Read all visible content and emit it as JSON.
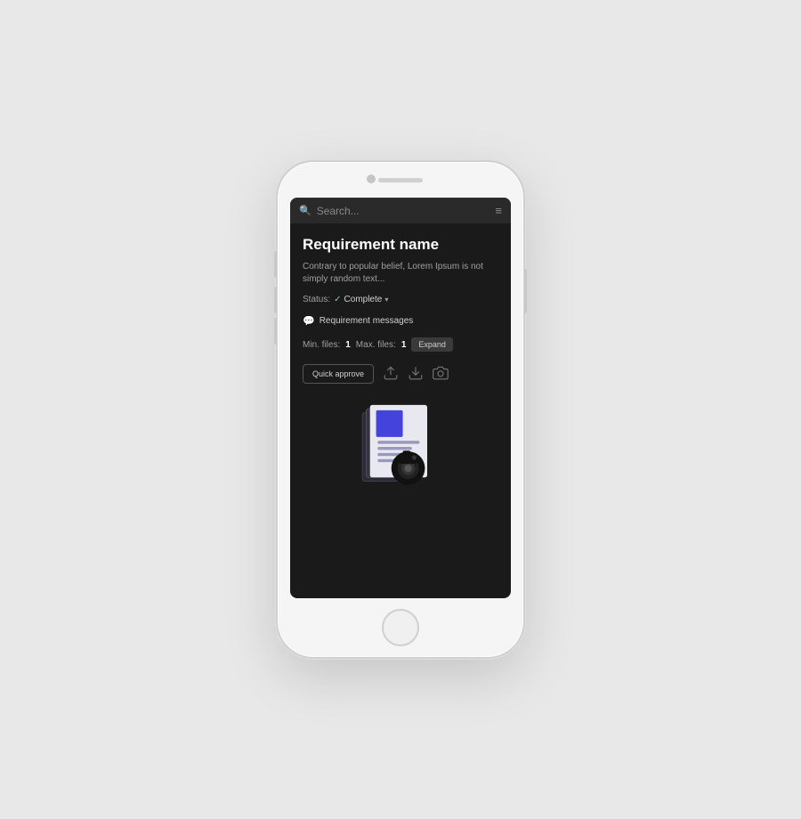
{
  "phone": {
    "search": {
      "placeholder": "Search...",
      "filter_icon": "≡"
    },
    "requirement": {
      "title": "Requirement name",
      "description": "Contrary to popular belief, Lorem Ipsum is not simply random text...",
      "status_label": "Status:",
      "status_value": "Complete",
      "messages_label": "Requirement messages",
      "min_files_label": "Min. files:",
      "min_files_value": "1",
      "max_files_label": "Max. files:",
      "max_files_value": "1",
      "expand_label": "Expand",
      "quick_approve_label": "Quick approve"
    },
    "colors": {
      "bg": "#1a1a1a",
      "search_bg": "#2a2a2a",
      "accent_blue": "#4444ff",
      "status_green": "#6fcf97"
    }
  }
}
